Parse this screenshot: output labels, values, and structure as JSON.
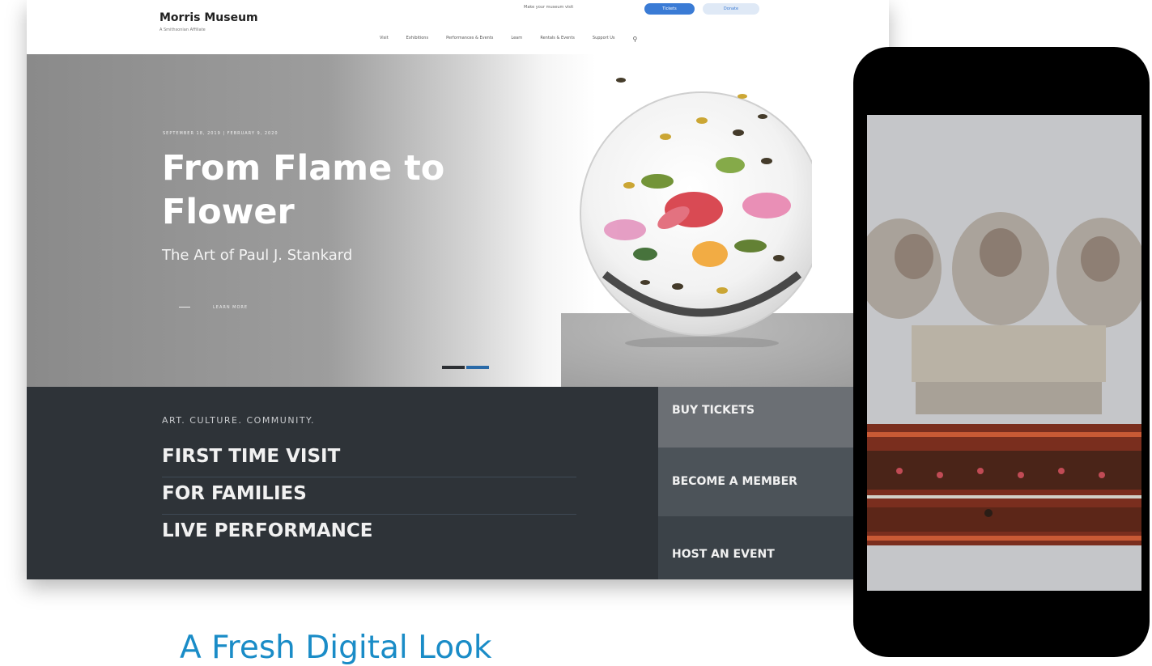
{
  "site": {
    "logo_title": "Morris Museum",
    "logo_subtitle": "A Smithsonian Affiliate",
    "utility_link": "Make your museum visit",
    "tickets_button": "Tickets",
    "donate_button": "Donate"
  },
  "nav": {
    "items": [
      "Visit",
      "Exhibitions",
      "Performances & Events",
      "Learn",
      "Rentals & Events",
      "Support Us"
    ]
  },
  "hero": {
    "date_range": "SEPTEMBER 18, 2019 | FEBRUARY 9, 2020",
    "title": "From Flame to Flower",
    "subtitle": "The Art of Paul J. Stankard",
    "cta": "LEARN MORE"
  },
  "bottom": {
    "tagline": "ART. CULTURE. COMMUNITY.",
    "visit_links": [
      "FIRST TIME VISIT",
      "FOR FAMILIES",
      "LIVE PERFORMANCE"
    ],
    "side_buttons": [
      "BUY TICKETS",
      "BECOME A MEMBER",
      "HOST AN EVENT"
    ]
  },
  "caption": "A Fresh Digital Look",
  "colors": {
    "caption_blue": "#1a8cc7",
    "dark_panel": "#2e3338",
    "tickets_blue": "#3a7bd5"
  }
}
